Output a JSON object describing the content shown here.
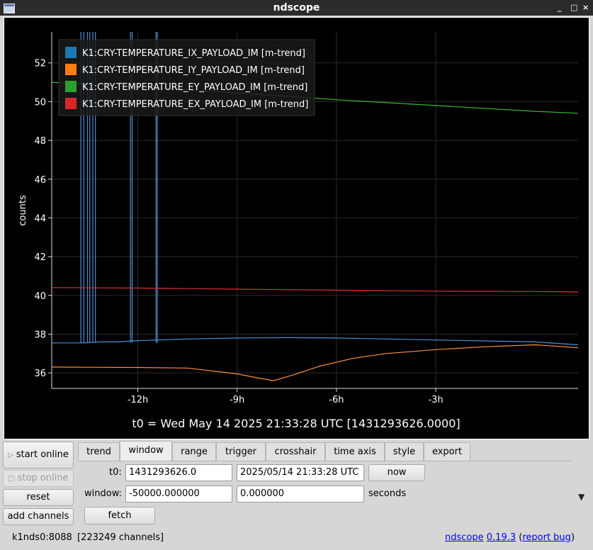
{
  "window": {
    "title": "ndscope",
    "controls": [
      "_",
      "□",
      "×"
    ]
  },
  "plot": {
    "t0_label": "t0 = Wed May 14 2025 21:33:28 UTC [1431293626.0000]",
    "background": "#000000"
  },
  "chart_data": {
    "type": "line",
    "ylabel": "counts",
    "xlabel": "",
    "xlim": [
      -14.6,
      1.3
    ],
    "ylim": [
      35.2,
      53.6
    ],
    "x_ticks": [
      {
        "v": -12,
        "label": "-12h"
      },
      {
        "v": -9,
        "label": "-9h"
      },
      {
        "v": -6,
        "label": "-6h"
      },
      {
        "v": -3,
        "label": "-3h"
      }
    ],
    "y_ticks": [
      36,
      38,
      40,
      42,
      44,
      46,
      48,
      50,
      52
    ],
    "grid": true,
    "legend_position": "top-left",
    "series": [
      {
        "name": "K1:CRY-TEMPERATURE_IX_PAYLOAD_IM [m-trend]",
        "color": "#1f77b4",
        "line_color": "#4a90d9",
        "x": [
          -14.6,
          -13.6,
          -13.15,
          -12.6,
          -12.2,
          -11.4,
          -10.5,
          -9.0,
          -7.5,
          -6.0,
          -4.5,
          -3.0,
          -1.5,
          0.0,
          1.3
        ],
        "y": [
          37.55,
          37.55,
          37.6,
          37.6,
          37.65,
          37.7,
          37.75,
          37.8,
          37.82,
          37.8,
          37.75,
          37.7,
          37.65,
          37.6,
          37.45
        ],
        "spikes": [
          [
            -13.72,
            53.6
          ],
          [
            -13.63,
            53.6
          ],
          [
            -13.52,
            53.6
          ],
          [
            -13.45,
            53.6
          ],
          [
            -13.36,
            53.6
          ],
          [
            -13.28,
            53.6
          ],
          [
            -12.22,
            53.6
          ],
          [
            -12.17,
            53.6
          ],
          [
            -11.45,
            53.6
          ],
          [
            -11.41,
            53.6
          ]
        ]
      },
      {
        "name": "K1:CRY-TEMPERATURE_IY_PAYLOAD_IM [m-trend]",
        "color": "#ff7f0e",
        "line_color": "#ff8c3a",
        "x": [
          -14.6,
          -12.0,
          -10.5,
          -9.0,
          -8.4,
          -7.9,
          -7.3,
          -6.5,
          -5.5,
          -4.5,
          -3.0,
          -1.5,
          0.0,
          1.3
        ],
        "y": [
          36.3,
          36.28,
          36.25,
          35.95,
          35.75,
          35.6,
          35.9,
          36.35,
          36.75,
          37.0,
          37.2,
          37.35,
          37.45,
          37.3
        ]
      },
      {
        "name": "K1:CRY-TEMPERATURE_EY_PAYLOAD_IM [m-trend]",
        "color": "#2ca02c",
        "line_color": "#3cb53c",
        "x": [
          -14.6,
          -12.0,
          -9.0,
          -6.0,
          -3.0,
          0.0,
          1.3
        ],
        "y": [
          51.0,
          50.75,
          50.45,
          50.1,
          49.8,
          49.5,
          49.4
        ]
      },
      {
        "name": "K1:CRY-TEMPERATURE_EX_PAYLOAD_IM [m-trend]",
        "color": "#d62728",
        "line_color": "#e03030",
        "x": [
          -14.6,
          -12.0,
          -9.0,
          -6.0,
          -3.0,
          0.0,
          1.3
        ],
        "y": [
          40.4,
          40.38,
          40.32,
          40.27,
          40.22,
          40.2,
          40.18
        ]
      }
    ]
  },
  "sidebar": {
    "start_online": "start online",
    "stop_online": "stop online",
    "reset": "reset",
    "add_channels": "add channels"
  },
  "tabs": [
    "trend",
    "window",
    "range",
    "trigger",
    "crosshair",
    "time axis",
    "style",
    "export"
  ],
  "active_tab": "window",
  "window_tab": {
    "t0_label": "t0:",
    "t0_gps": "1431293626.0",
    "t0_utc": "2025/05/14 21:33:28 UTC",
    "now_button": "now",
    "window_label": "window:",
    "window_start": "-50000.000000",
    "window_end": "0.000000",
    "seconds_label": "seconds",
    "fetch_button": "fetch"
  },
  "status": {
    "server": "k1nds0:8088",
    "channels": "[223249 channels]",
    "app_link": "ndscope",
    "version_link": "0.19.3",
    "paren_open": "(",
    "report_bug": "report bug",
    "paren_close": ")"
  }
}
